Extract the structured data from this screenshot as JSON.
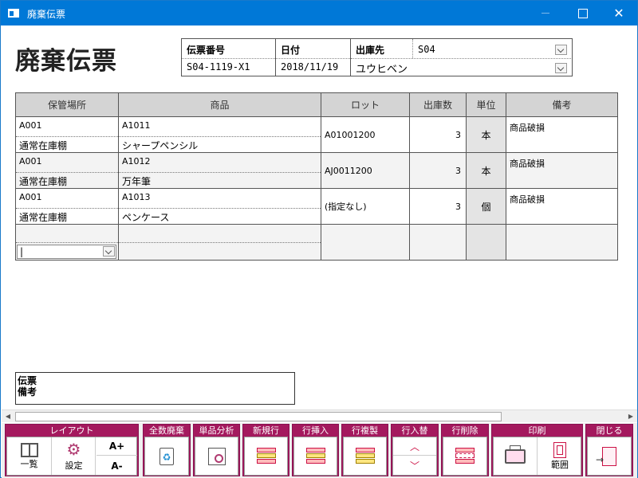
{
  "window": {
    "title": "廃棄伝票"
  },
  "page": {
    "title": "廃棄伝票"
  },
  "header": {
    "slip_no_label": "伝票番号",
    "slip_no": "S04-1119-X1",
    "date_label": "日付",
    "date": "2018/11/19",
    "dest_label": "出庫先",
    "dest_code": "S04",
    "dest_name": "ユウヒベン"
  },
  "grid": {
    "columns": [
      "保管場所",
      "商品",
      "ロット",
      "出庫数",
      "単位",
      "備考"
    ],
    "rows": [
      {
        "location_code": "A001",
        "location_name": "通常在庫棚",
        "item_code": "A1011",
        "item_name": "シャープペンシル",
        "lot": "A01001200",
        "qty": "3",
        "unit": "本",
        "note": "商品破損"
      },
      {
        "location_code": "A001",
        "location_name": "通常在庫棚",
        "item_code": "A1012",
        "item_name": "万年筆",
        "lot": "AJ0011200",
        "qty": "3",
        "unit": "本",
        "note": "商品破損"
      },
      {
        "location_code": "A001",
        "location_name": "通常在庫棚",
        "item_code": "A1013",
        "item_name": "ペンケース",
        "lot": "(指定なし)",
        "qty": "3",
        "unit": "個",
        "note": "商品破損"
      }
    ],
    "new_row_input": "|"
  },
  "memo": {
    "label_line1": "伝票",
    "label_line2": "備考"
  },
  "toolbar": {
    "layout_label": "レイアウト",
    "list_label": "一覧",
    "settings_label": "設定",
    "font_up_label": "A+",
    "font_down_label": "A-",
    "discard_all_label": "全数廃棄",
    "item_analysis_label": "単品分析",
    "new_row_label": "新規行",
    "insert_row_label": "行挿入",
    "copy_row_label": "行複製",
    "swap_row_label": "行入替",
    "delete_row_label": "行削除",
    "print_label": "印刷",
    "range_label": "範囲",
    "close_label": "閉じる"
  },
  "colors": {
    "titlebar": "#0078d7",
    "toolbar_accent": "#a4195e",
    "header_grey": "#d4d4d4"
  }
}
